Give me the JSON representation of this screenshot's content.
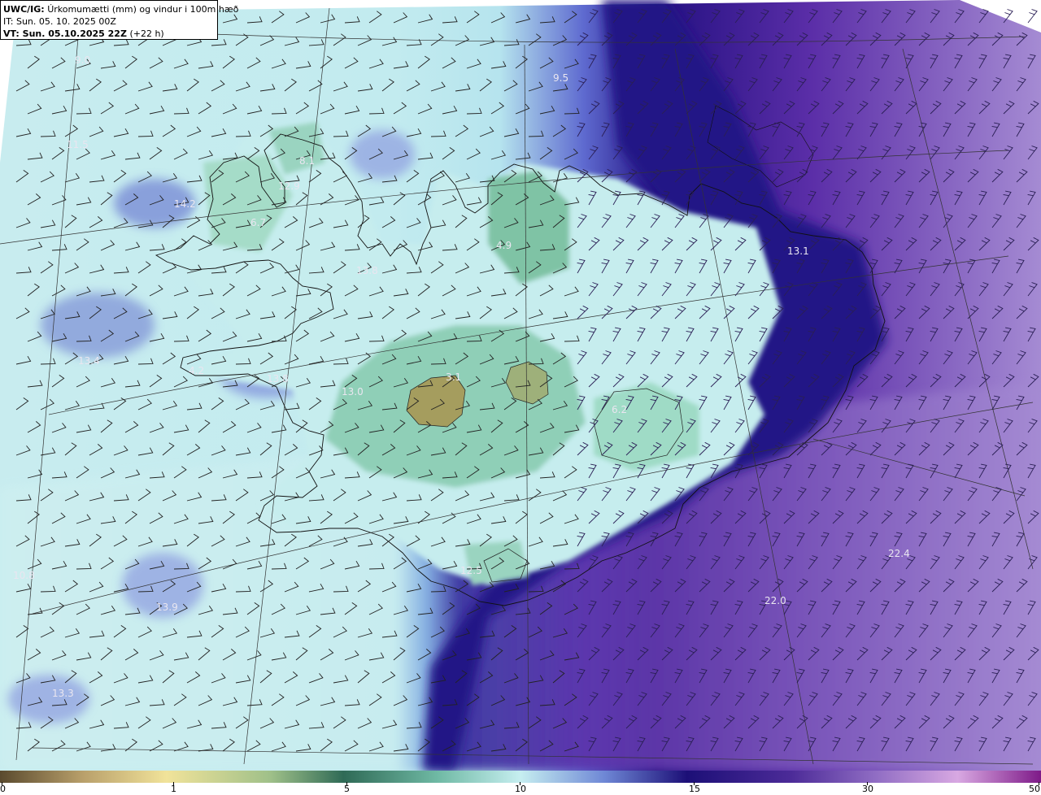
{
  "title": {
    "model": "UWC/IG:",
    "description": "Úrkomumætti (mm) og vindur i 100m hæð",
    "init_time": "IT: Sun. 05. 10. 2025 00Z",
    "valid_time_label": "VT: Sun. 05.10.2025 22Z",
    "lead": "(+22 h)"
  },
  "colorbar": {
    "ticks": [
      "0",
      "1",
      "5",
      "10",
      "15",
      "30",
      "50"
    ]
  },
  "values": [
    {
      "text": "9.0"
    },
    {
      "text": "9.5"
    },
    {
      "text": "11.5"
    },
    {
      "text": "8.1"
    },
    {
      "text": "12.9"
    },
    {
      "text": "14.2"
    },
    {
      "text": "6.7"
    },
    {
      "text": "13.8"
    },
    {
      "text": "4.9"
    },
    {
      "text": "13.1"
    },
    {
      "text": "13.4"
    },
    {
      "text": "4.2"
    },
    {
      "text": "13.8"
    },
    {
      "text": "3.1"
    },
    {
      "text": "13.0"
    },
    {
      "text": "6.2"
    },
    {
      "text": "22.4"
    },
    {
      "text": "22.0"
    },
    {
      "text": "10.8"
    },
    {
      "text": "13.9"
    },
    {
      "text": "13.3"
    },
    {
      "text": "12.5"
    }
  ],
  "colors": {
    "ocean_east": "#8f6cc3",
    "coast_band": "#22117a",
    "land_light": "#c7eeee",
    "land_green": "#7dbfa6",
    "highland": "#a49a5a"
  }
}
